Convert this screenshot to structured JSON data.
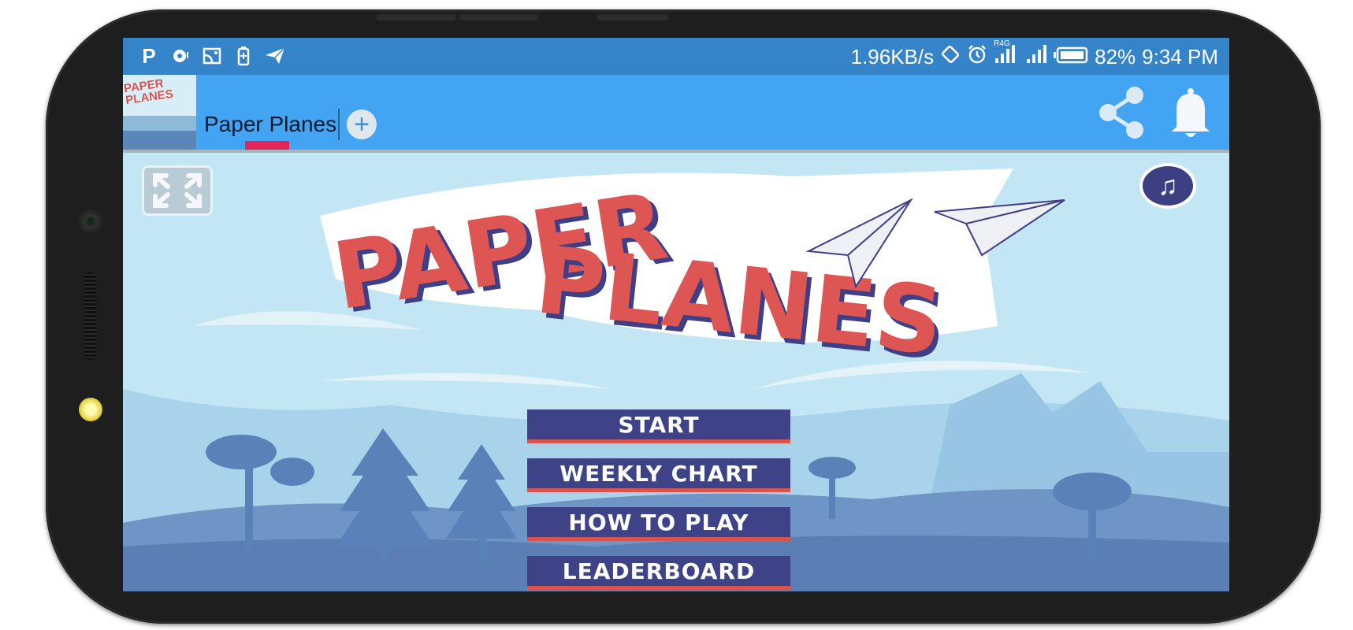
{
  "status_bar": {
    "left_icons": [
      "p-app-icon",
      "sync-icon",
      "cast-icon",
      "battery-saver-icon",
      "telegram-icon"
    ],
    "network_speed": "1.96KB/s",
    "right_icons": [
      "rotate-icon",
      "alarm-icon",
      "signal-r4g-icon",
      "signal-icon"
    ],
    "network_tag": "R4G",
    "battery": "82%",
    "time": "9:34 PM"
  },
  "app_bar": {
    "thumbnail_title": "PAPER PLANES",
    "tab_label": "Paper Planes",
    "add_tab_symbol": "+",
    "actions": [
      "share-icon",
      "bell-icon"
    ]
  },
  "game": {
    "logo_line1": "PAPER",
    "logo_line2": "PLANES",
    "fullscreen_icon": "expand-arrows-icon",
    "music_icon": "music-note-icon",
    "music_glyph": "♫",
    "menu": [
      {
        "label": "START"
      },
      {
        "label": "WEEKLY CHART"
      },
      {
        "label": "HOW TO PLAY"
      },
      {
        "label": "LEADERBOARD"
      }
    ]
  },
  "colors": {
    "status_bar": "#3583c9",
    "app_bar": "#42a4f2",
    "sky": "#c3e6f4",
    "button_bg": "#3e4388",
    "button_accent": "#d9534f",
    "logo_red": "#dd5653",
    "tab_indicator": "#e2245a"
  }
}
